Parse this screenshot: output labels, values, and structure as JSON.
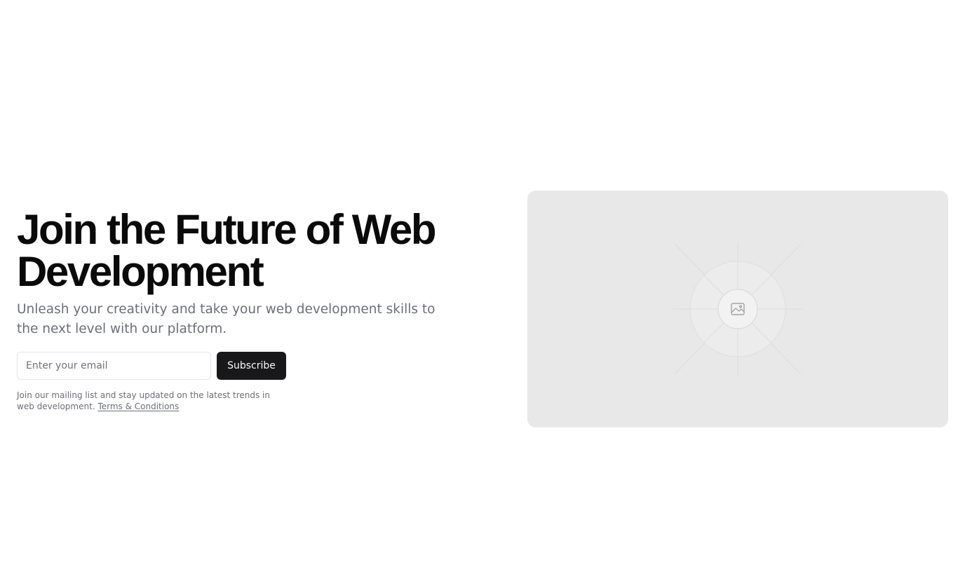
{
  "hero": {
    "title": "Join the Future of Web Development",
    "subtitle": "Unleash your creativity and take your web development skills to the next level with our platform."
  },
  "signup": {
    "email_placeholder": "Enter your email",
    "subscribe_label": "Subscribe",
    "fine_print": "Join our mailing list and stay updated on the latest trends in web development.",
    "terms_label": "Terms & Conditions"
  },
  "image_placeholder": {
    "icon": "image-icon",
    "background_color": "#e8e8e8"
  },
  "colors": {
    "heading": "#0a0a0a",
    "muted_text": "#6b6f76",
    "button_bg": "#18181b",
    "button_text": "#fafafa"
  }
}
